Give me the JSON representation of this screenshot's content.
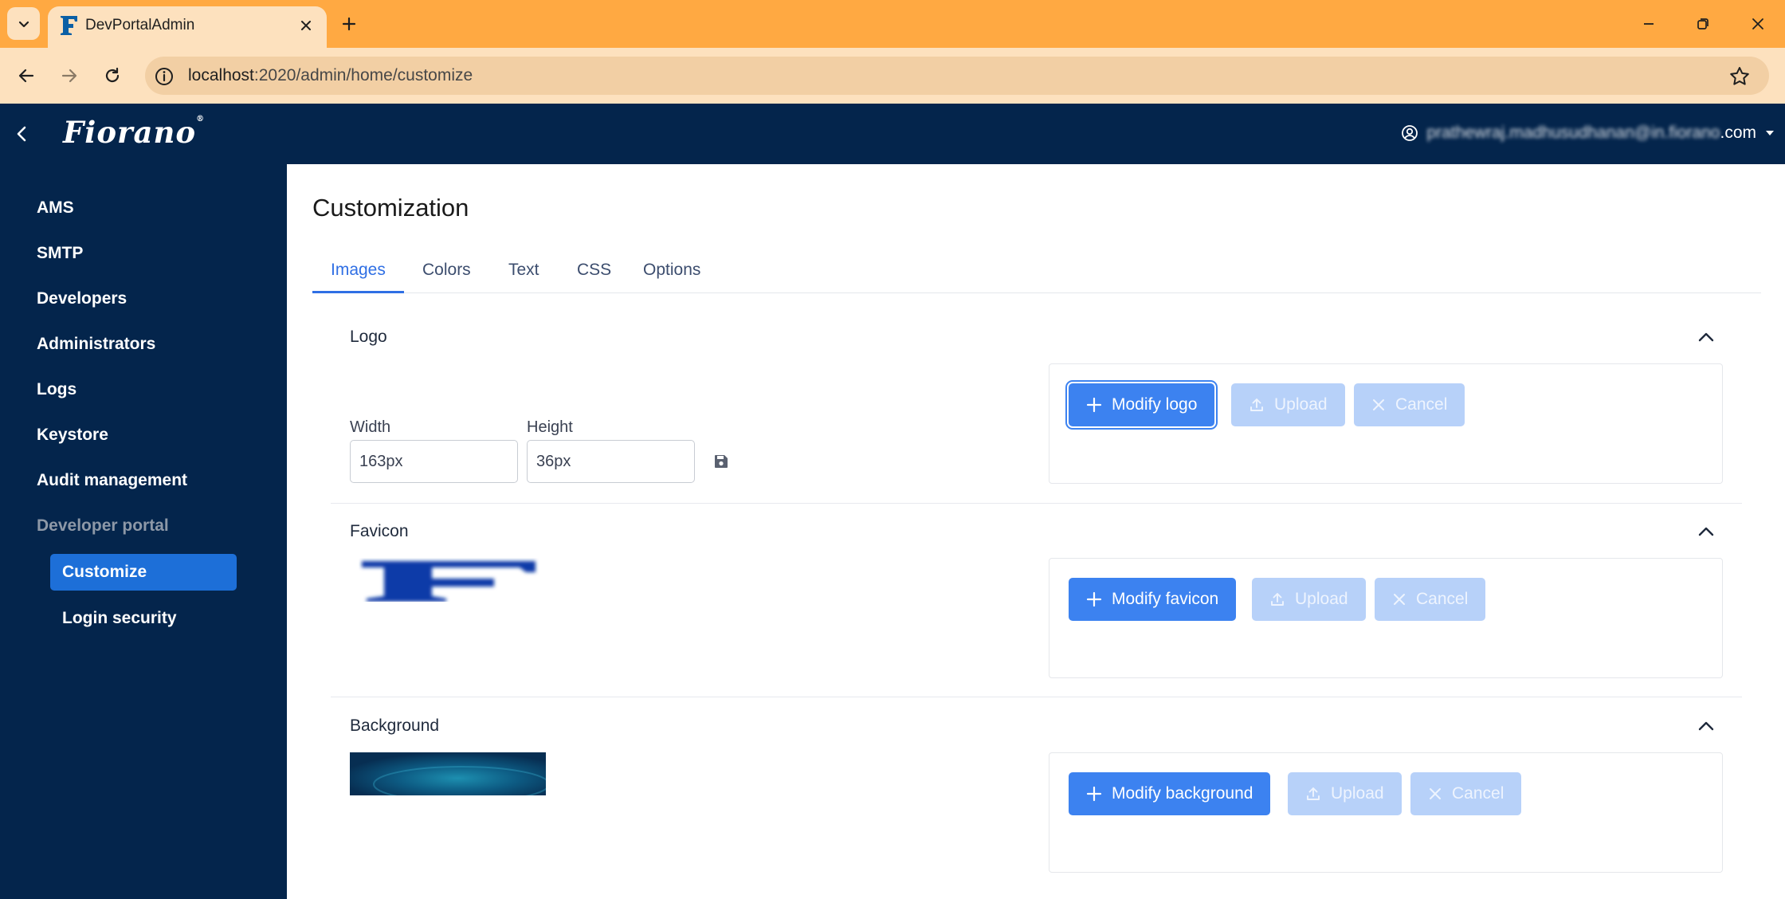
{
  "browser": {
    "tab_title": "DevPortalAdmin",
    "url_host": "localhost",
    "url_path": ":2020/admin/home/customize"
  },
  "app": {
    "brand": "Fiorano",
    "brand_mark": "®",
    "user_email_blurred": "prathewraj.madhusudhanan@in.fiorano",
    "user_email_suffix": ".com"
  },
  "sidebar": {
    "items": [
      {
        "label": "AMS"
      },
      {
        "label": "SMTP"
      },
      {
        "label": "Developers"
      },
      {
        "label": "Administrators"
      },
      {
        "label": "Logs"
      },
      {
        "label": "Keystore"
      },
      {
        "label": "Audit management"
      },
      {
        "label": "Developer portal"
      }
    ],
    "sub_items": [
      {
        "label": "Customize",
        "active": true
      },
      {
        "label": "Login security"
      }
    ]
  },
  "main": {
    "title": "Customization",
    "tabs": [
      {
        "label": "Images",
        "active": true
      },
      {
        "label": "Colors"
      },
      {
        "label": "Text"
      },
      {
        "label": "CSS"
      },
      {
        "label": "Options"
      }
    ],
    "logo": {
      "title": "Logo",
      "width_label": "Width",
      "width_value": "163px",
      "height_label": "Height",
      "height_value": "36px",
      "modify_label": "Modify logo",
      "upload_label": "Upload",
      "cancel_label": "Cancel"
    },
    "favicon": {
      "title": "Favicon",
      "modify_label": "Modify favicon",
      "upload_label": "Upload",
      "cancel_label": "Cancel"
    },
    "background": {
      "title": "Background",
      "modify_label": "Modify background",
      "upload_label": "Upload",
      "cancel_label": "Cancel"
    }
  },
  "colors": {
    "tabbar": "#ffa942",
    "toolbar": "#fde1be",
    "navy": "#04254c",
    "accent": "#3c82f0",
    "active_nav": "#1d6fd8"
  }
}
